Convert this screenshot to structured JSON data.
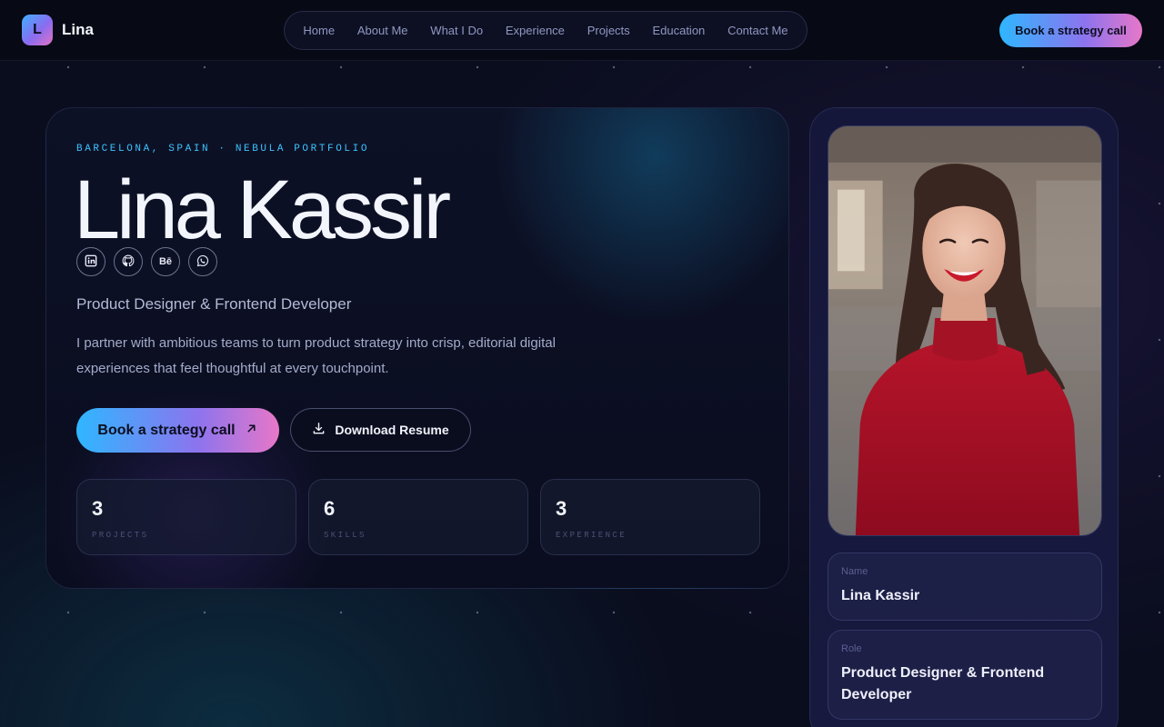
{
  "brand": {
    "initial": "L",
    "name": "Lina"
  },
  "nav": {
    "links": [
      "Home",
      "About Me",
      "What I Do",
      "Experience",
      "Projects",
      "Education",
      "Contact Me"
    ],
    "cta": "Book a strategy call"
  },
  "hero": {
    "eyebrow": "BARCELONA, SPAIN · NEBULA PORTFOLIO",
    "name": "Lina Kassir",
    "socials": [
      {
        "icon": "linkedin-icon"
      },
      {
        "icon": "github-icon"
      },
      {
        "icon": "behance-icon",
        "text": "Bē"
      },
      {
        "icon": "whatsapp-icon"
      }
    ],
    "role": "Product Designer & Frontend Developer",
    "bio": "I partner with ambitious teams to turn product strategy into crisp, editorial digital experiences that feel thoughtful at every touchpoint.",
    "primary_cta": "Book a strategy call",
    "secondary_cta": "Download Resume",
    "stats": [
      {
        "value": "3",
        "label": "PROJECTS"
      },
      {
        "value": "6",
        "label": "SKILLS"
      },
      {
        "value": "3",
        "label": "EXPERIENCE"
      }
    ]
  },
  "profile": {
    "name_label": "Name",
    "name_value": "Lina Kassir",
    "role_label": "Role",
    "role_value": "Product Designer & Frontend Developer"
  },
  "colors": {
    "accent_cyan": "#2fb6ff",
    "accent_violet": "#8d74ee",
    "accent_pink": "#e777c8",
    "background": "#0a0d1e"
  }
}
